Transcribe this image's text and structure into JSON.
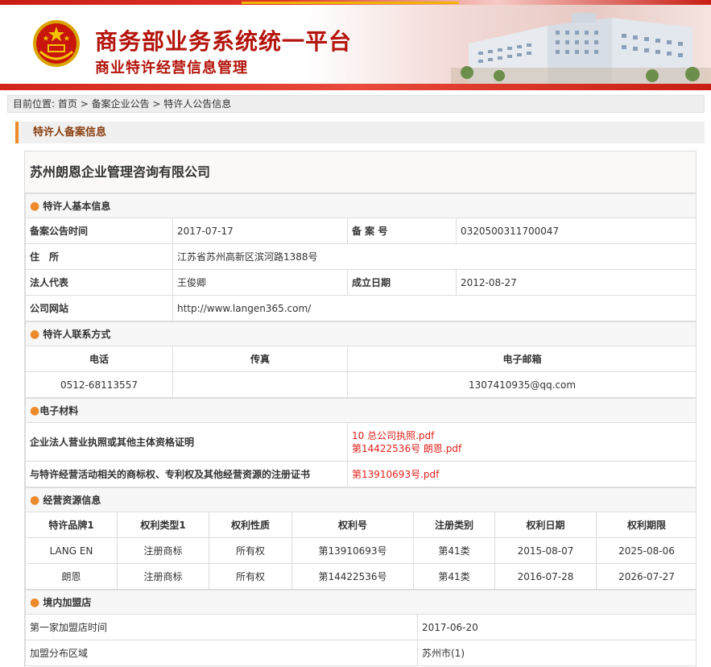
{
  "header": {
    "title": "商务部业务系统统一平台",
    "subtitle": "商业特许经营信息管理"
  },
  "breadcrumb": {
    "prefix": "目前位置:",
    "items": [
      "首页",
      "备案企业公告",
      "特许人公告信息"
    ],
    "separator": " > "
  },
  "section_title": "特许人备案信息",
  "company_name": "苏州朗恩企业管理咨询有限公司",
  "basic_info": {
    "heading": "特许人基本信息",
    "announce_date_label": "备案公告时间",
    "announce_date": "2017-07-17",
    "record_no_label": "备 案 号",
    "record_no": "0320500311700047",
    "address_label": "住　所",
    "address": "江苏省苏州高新区滨河路1388号",
    "legal_rep_label": "法人代表",
    "legal_rep": "王俊卿",
    "founded_label": "成立日期",
    "founded": "2012-08-27",
    "website_label": "公司网站",
    "website": "http://www.langen365.com/"
  },
  "contact": {
    "heading": "特许人联系方式",
    "phone_label": "电话",
    "fax_label": "传真",
    "email_label": "电子邮箱",
    "phone": "0512-68113557",
    "fax": "",
    "email": "1307410935@qq.com"
  },
  "materials": {
    "heading": "电子材料",
    "license_label": "企业法人营业执照或其他主体资格证明",
    "license_files": [
      "10 总公司执照.pdf",
      "第14422536号 朗恩.pdf"
    ],
    "trademark_label": "与特许经营活动相关的商标权、专利权及其他经营资源的注册证书",
    "trademark_files": [
      "第13910693号.pdf"
    ]
  },
  "resources": {
    "heading": "经营资源信息",
    "columns": [
      "特许品牌1",
      "权利类型1",
      "权利性质",
      "权利号",
      "注册类别",
      "权利日期",
      "权利期限"
    ],
    "rows": [
      [
        "LANG EN",
        "注册商标",
        "所有权",
        "第13910693号",
        "第41类",
        "2015-08-07",
        "2025-08-06"
      ],
      [
        "朗恩",
        "注册商标",
        "所有权",
        "第14422536号",
        "第41类",
        "2016-07-28",
        "2026-07-27"
      ]
    ]
  },
  "domestic": {
    "heading": "境内加盟店",
    "first_store_label": "第一家加盟店时间",
    "first_store": "2017-06-20",
    "area_label": "加盟分布区域",
    "area": "苏州市(1)"
  },
  "colors": {
    "brand_red": "#b3140b",
    "accent_orange": "#ec8a2c",
    "link_red": "#e0201a"
  }
}
